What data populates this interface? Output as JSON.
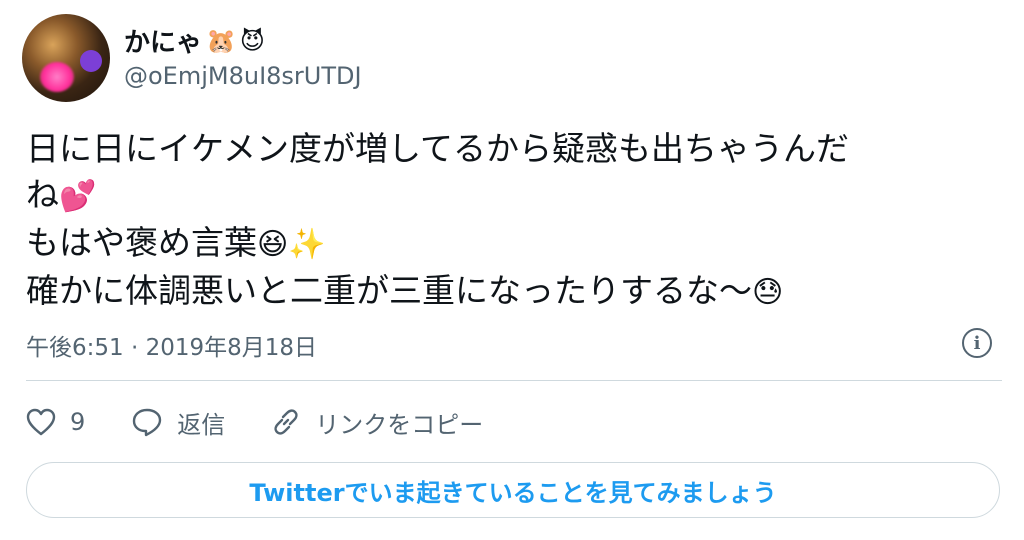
{
  "author": {
    "name": "かにゃ",
    "name_emojis": [
      "🐹",
      "😈"
    ],
    "handle": "@oEmjM8uI8srUTDJ"
  },
  "tweet": {
    "lines": [
      "日に日にイケメン度が増してるから疑惑も出ちゃうんだ",
      "ね",
      "もはや褒め言葉",
      "確かに体調悪いと二重が三重になったりするな〜"
    ],
    "line_emojis": [
      "",
      "💕",
      "😆✨",
      "😓"
    ]
  },
  "meta": {
    "timestamp": "午後6:51 · 2019年8月18日",
    "info_icon": "i"
  },
  "actions": {
    "like_count": "9",
    "reply_label": "返信",
    "copy_link_label": "リンクをコピー"
  },
  "cta": {
    "label": "Twitterでいま起きていることを見てみましょう"
  },
  "colors": {
    "text": "#0f1419",
    "secondary": "#536471",
    "accent": "#1d9bf0",
    "border": "#cfd9de"
  }
}
